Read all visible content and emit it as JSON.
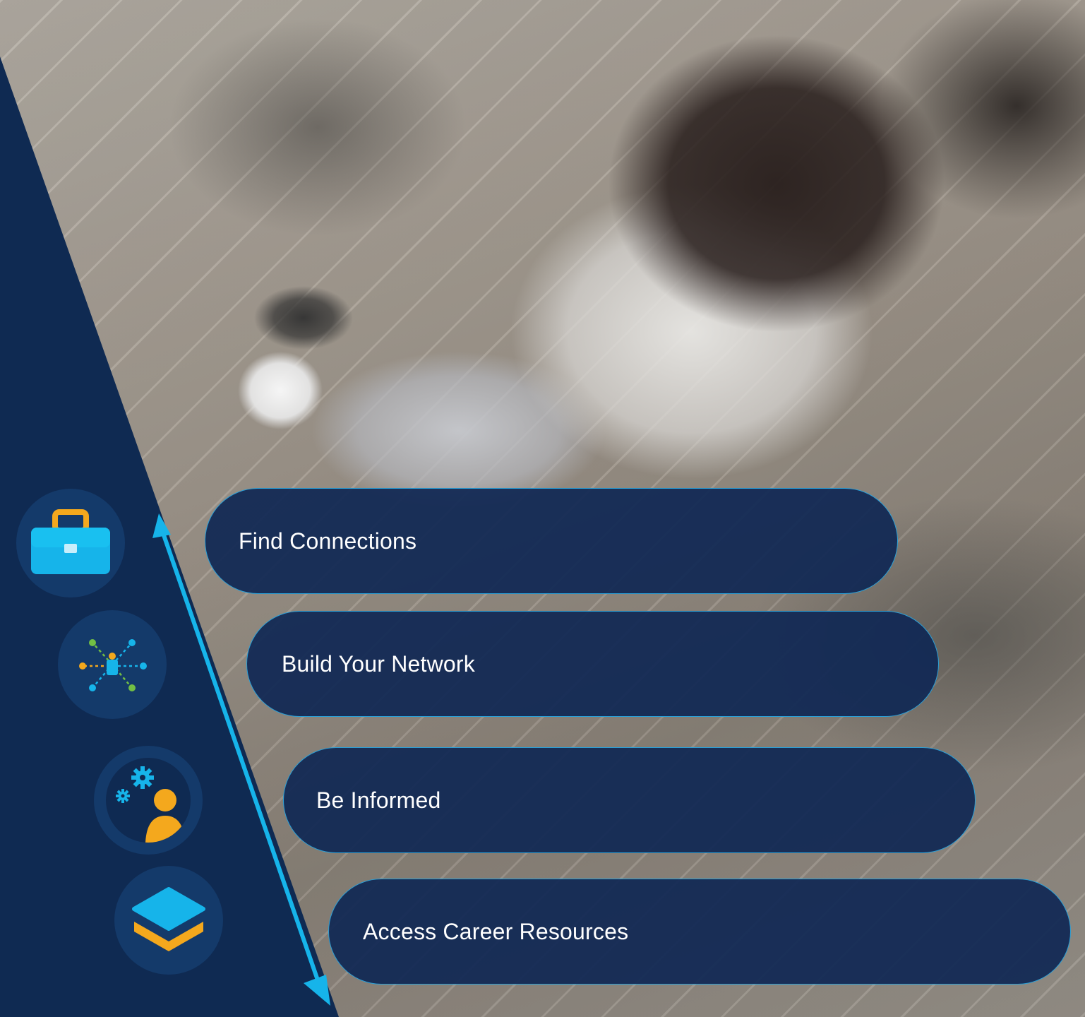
{
  "menu": {
    "items": [
      {
        "label": "Find Connections",
        "icon": "briefcase-icon"
      },
      {
        "label": "Build Your Network",
        "icon": "network-icon"
      },
      {
        "label": "Be Informed",
        "icon": "person-gears-icon"
      },
      {
        "label": "Access Career Resources",
        "icon": "layers-icon"
      }
    ]
  },
  "colors": {
    "navy": "#0f2a52",
    "icon_circle": "#143a6a",
    "accent_blue": "#16b4ea",
    "accent_orange": "#f4a81d",
    "accent_green": "#72bf44",
    "pill_border": "#2a9fd6"
  }
}
